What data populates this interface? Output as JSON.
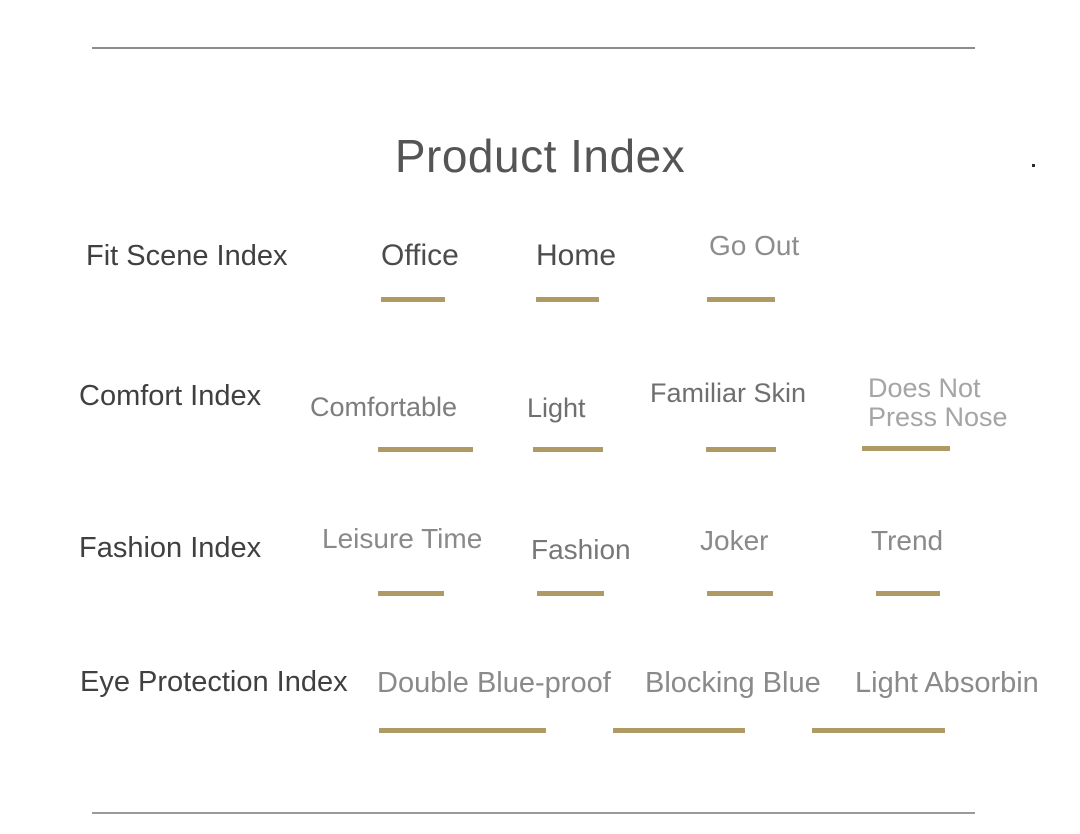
{
  "page": {
    "title": "Product Index",
    "accent_color": "#b09a63",
    "label_color": "#404040",
    "rule_color": "#8d8d8d",
    "background": "#ffffff"
  },
  "rows": [
    {
      "label": "Fit Scene Index",
      "items": [
        {
          "text": "Office",
          "color": "#4c4c4c"
        },
        {
          "text": "Home",
          "color": "#4c4c4c"
        },
        {
          "text": "Go Out",
          "color": "#8d8d8d"
        }
      ]
    },
    {
      "label": "Comfort Index",
      "items": [
        {
          "text": "Comfortable",
          "color": "#7d7d7d"
        },
        {
          "text": "Light",
          "color": "#6f6f6f"
        },
        {
          "text": "Familiar Skin",
          "color": "#6f6f6f"
        },
        {
          "text": "Does Not\nPress Nose",
          "color": "#a5a5a5"
        }
      ]
    },
    {
      "label": "Fashion Index",
      "items": [
        {
          "text": "Leisure Time",
          "color": "#8a8a8a"
        },
        {
          "text": "Fashion",
          "color": "#777777"
        },
        {
          "text": "Joker",
          "color": "#8a8a8a"
        },
        {
          "text": "Trend",
          "color": "#8a8a8a"
        }
      ]
    },
    {
      "label": "Eye Protection Index",
      "items": [
        {
          "text": "Double Blue-proof",
          "color": "#8a8a8a"
        },
        {
          "text": "Blocking Blue",
          "color": "#8a8a8a"
        },
        {
          "text": "Light Absorbin",
          "color": "#8a8a8a"
        }
      ]
    }
  ]
}
